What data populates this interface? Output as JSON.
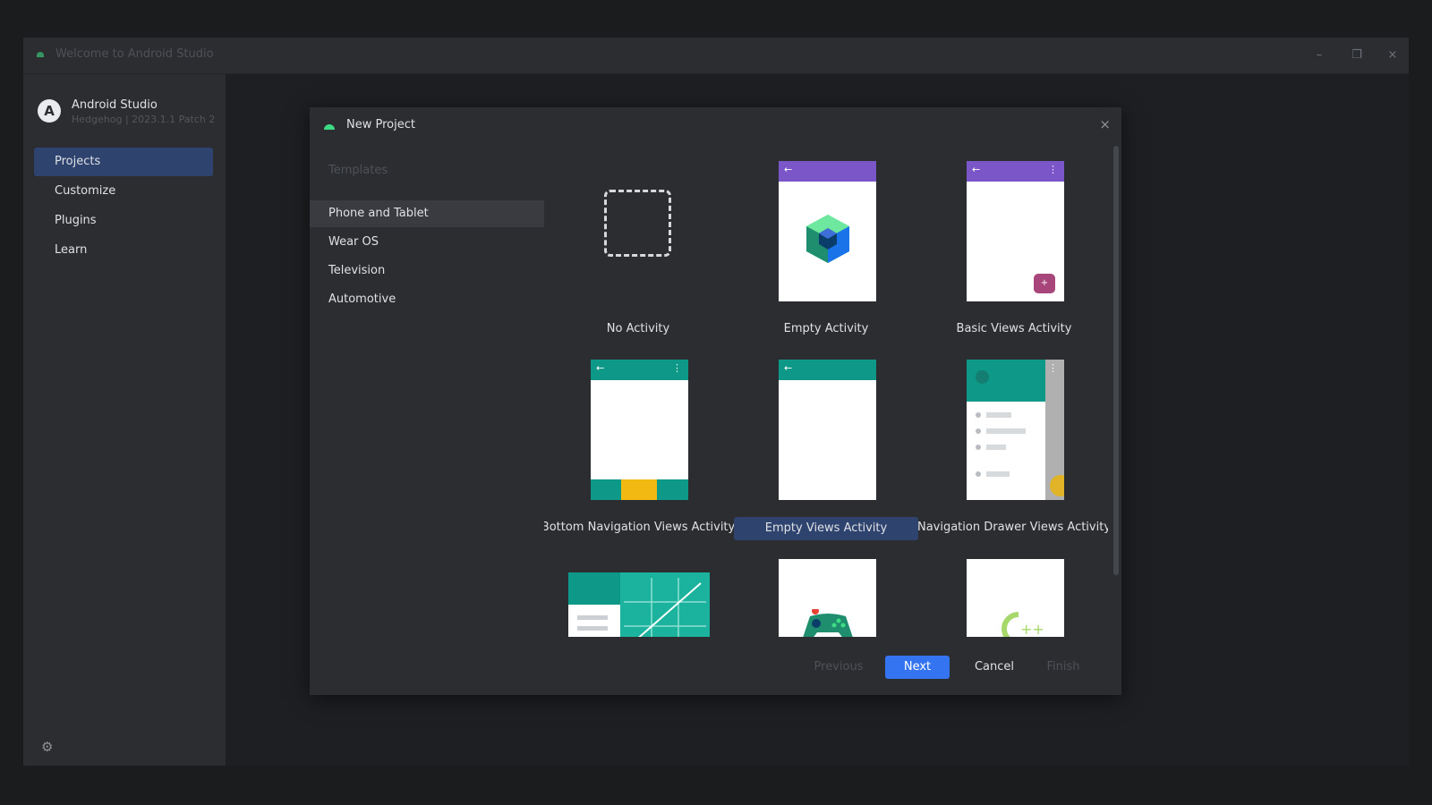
{
  "window": {
    "title": "Welcome to Android Studio",
    "controls": {
      "minimize": "–",
      "maximize": "❐",
      "close": "×"
    }
  },
  "brand": {
    "name": "Android Studio",
    "version": "Hedgehog | 2023.1.1 Patch 2",
    "logo_letter": "A"
  },
  "sidebar": {
    "items": [
      {
        "label": "Projects",
        "active": true
      },
      {
        "label": "Customize"
      },
      {
        "label": "Plugins"
      },
      {
        "label": "Learn"
      }
    ],
    "settings_icon": "⚙"
  },
  "dialog": {
    "title": "New Project",
    "close_icon": "×",
    "templates_label": "Templates",
    "categories": [
      {
        "label": "Phone and Tablet",
        "active": true
      },
      {
        "label": "Wear OS"
      },
      {
        "label": "Television"
      },
      {
        "label": "Automotive"
      }
    ],
    "templates": [
      {
        "label": "No Activity"
      },
      {
        "label": "Empty Activity"
      },
      {
        "label": "Basic Views Activity"
      },
      {
        "label": "Bottom Navigation Views Activity"
      },
      {
        "label": "Empty Views Activity",
        "selected": true
      },
      {
        "label": "Navigation Drawer Views Activity"
      }
    ],
    "buttons": {
      "previous": "Previous",
      "next": "Next",
      "cancel": "Cancel",
      "finish": "Finish"
    }
  },
  "icons": {
    "back": "←",
    "more": "⋮",
    "fab_plus": "+"
  },
  "colors": {
    "accent": "#3574f0",
    "selection": "#2e436e",
    "purple_bar": "#7a56c8",
    "teal_bar": "#0e9887",
    "android_green": "#3ddc84"
  }
}
